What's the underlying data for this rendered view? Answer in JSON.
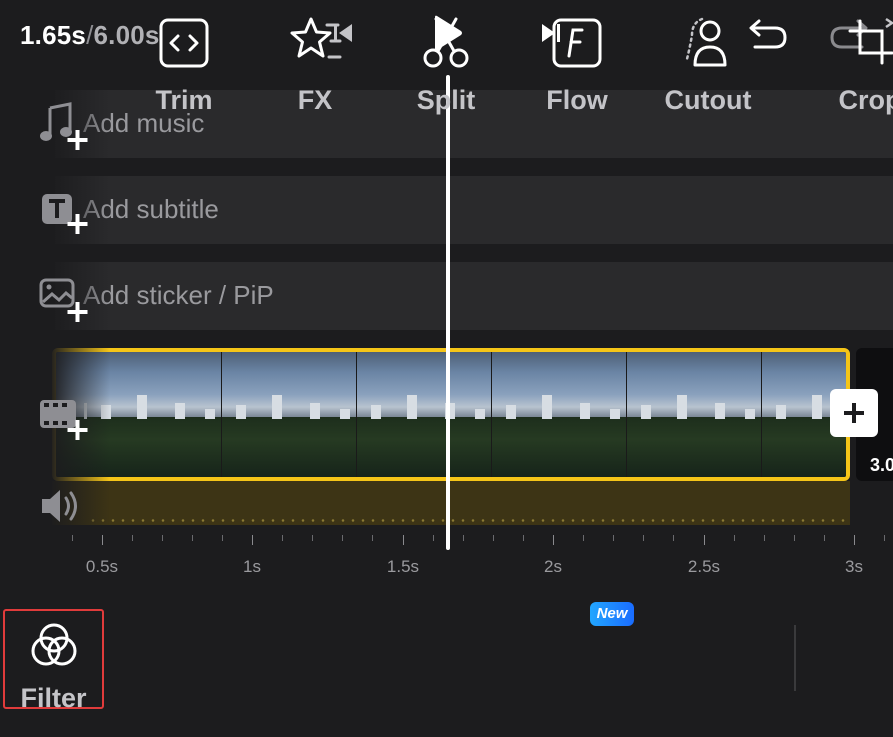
{
  "header": {
    "current_time": "1.65s",
    "separator": "/",
    "total_time": "6.00s"
  },
  "tracks": {
    "music_label": "Add music",
    "subtitle_label": "Add subtitle",
    "sticker_label": "Add sticker / PiP"
  },
  "timeline": {
    "next_clip_label": "3.0",
    "ruler_labels": [
      "0.5s",
      "1s",
      "1.5s",
      "2s",
      "2.5s",
      "3s"
    ]
  },
  "toolbar": {
    "items": [
      {
        "label": "Filter"
      },
      {
        "label": "Trim"
      },
      {
        "label": "FX"
      },
      {
        "label": "Split"
      },
      {
        "label": "Flow"
      },
      {
        "label": "Cutout"
      },
      {
        "label": "Crop"
      }
    ],
    "new_badge": "New",
    "selected": "Filter"
  },
  "colors": {
    "accent_yellow": "#f5c518",
    "selection_red": "#e03b3b",
    "background": "#1c1c1e",
    "badge_blue": "#1a6cff"
  }
}
